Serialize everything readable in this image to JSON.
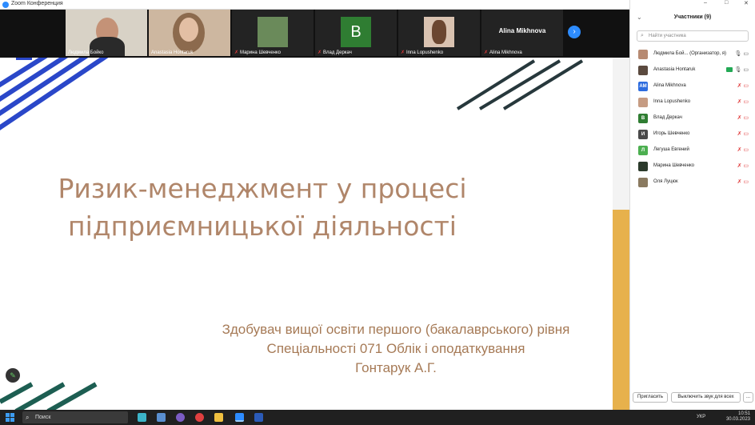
{
  "window": {
    "title": "Zoom Конференция"
  },
  "video_strip": {
    "tiles": [
      {
        "name": "Людмила Бойко",
        "muted": false,
        "kind": "video"
      },
      {
        "name": "Anastasia Hontaruk",
        "muted": false,
        "kind": "video"
      },
      {
        "name": "Марина Шевченко",
        "muted": true,
        "kind": "photo"
      },
      {
        "name": "Влад Деркач",
        "muted": true,
        "kind": "letter",
        "letter": "B",
        "color": "#2f7d32"
      },
      {
        "name": "Inna Lopushenko",
        "muted": true,
        "kind": "photo"
      },
      {
        "name": "Alina Mikhnova",
        "muted": true,
        "kind": "name",
        "center_name": "Alina Mikhnova"
      }
    ],
    "next_icon": "chevron-right-icon"
  },
  "slide": {
    "title_line1": "Ризик-менеджмент у процесі",
    "title_line2": "підприємницької діяльності",
    "sub_line1": "Здобувач вищої освіти першого (бакалаврського) рівня",
    "sub_line2": "Спеціальності 071 Облік і оподаткування",
    "sub_line3": "Гонтарук А.Г.",
    "accent_color": "#b0866a",
    "stripe_blue": "#2a47c9",
    "stripe_dark": "#27383c",
    "bar_color": "#e7b14c"
  },
  "participants_panel": {
    "header": "Участники (9)",
    "search_placeholder": "Найти участника",
    "participants": [
      {
        "name": "Людмила Бой... (Организатор, я)",
        "avatar_kind": "photo",
        "avatar_color": "#b78a72",
        "status": "on"
      },
      {
        "name": "Anastasia Hontaruk",
        "avatar_kind": "photo",
        "avatar_color": "#5b4a3f",
        "status": "video"
      },
      {
        "name": "Alina Mikhnova",
        "avatar_kind": "letter",
        "letter": "AM",
        "avatar_color": "#2d6cdf",
        "status": "muted"
      },
      {
        "name": "Inna Lopushenko",
        "avatar_kind": "photo",
        "avatar_color": "#c69c83",
        "status": "muted"
      },
      {
        "name": "Влад Деркач",
        "avatar_kind": "letter",
        "letter": "B",
        "avatar_color": "#2f7d32",
        "status": "muted"
      },
      {
        "name": "Игорь Шевченко",
        "avatar_kind": "letter",
        "letter": "И",
        "avatar_color": "#4a4a4a",
        "status": "muted"
      },
      {
        "name": "Легуша Евгений",
        "avatar_kind": "letter",
        "letter": "Л",
        "avatar_color": "#4caf50",
        "status": "muted"
      },
      {
        "name": "Марина Шевченко",
        "avatar_kind": "photo",
        "avatar_color": "#2b3a2b",
        "status": "muted"
      },
      {
        "name": "Оля Луцюк",
        "avatar_kind": "photo",
        "avatar_color": "#8a7a60",
        "status": "muted"
      }
    ],
    "invite_label": "Пригласить",
    "mute_all_label": "Выключить звук для всех",
    "more_label": "..."
  },
  "taskbar": {
    "search_label": "Поиск",
    "lang": "УКР",
    "time": "10:51",
    "date": "30.03.2023"
  }
}
